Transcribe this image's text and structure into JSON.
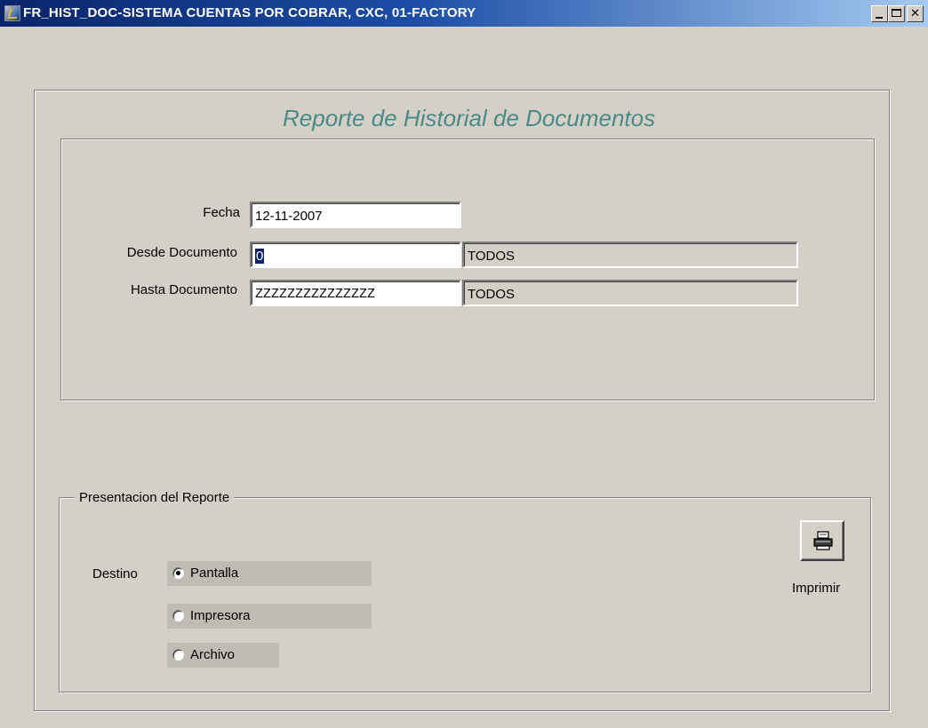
{
  "window": {
    "title": "FR_HIST_DOC-SISTEMA CUENTAS POR COBRAR, CXC, 01-FACTORY",
    "controls": {
      "minimize": "_",
      "maximize": "□",
      "close": "✕"
    }
  },
  "report": {
    "title": "Reporte de Historial de Documentos"
  },
  "params": {
    "fecha_label": "Fecha",
    "fecha_value": "12-11-2007",
    "desde_label": "Desde Documento",
    "desde_value": "0",
    "desde_desc": "TODOS",
    "hasta_label": "Hasta Documento",
    "hasta_value": "ZZZZZZZZZZZZZZZ",
    "hasta_desc": "TODOS"
  },
  "presentation": {
    "group_label": "Presentacion del Reporte",
    "destino_label": "Destino",
    "options": [
      {
        "label": "Pantalla",
        "selected": true
      },
      {
        "label": "Impresora",
        "selected": false
      },
      {
        "label": "Archivo",
        "selected": false
      }
    ],
    "print_label": "Imprimir",
    "print_icon": "printer-icon"
  },
  "colors": {
    "title_gradient_start": "#0a246a",
    "title_gradient_end": "#a6caf0",
    "report_title": "#4a8a86",
    "window_bg": "#d4d0c8",
    "selection": "#0a246a"
  }
}
